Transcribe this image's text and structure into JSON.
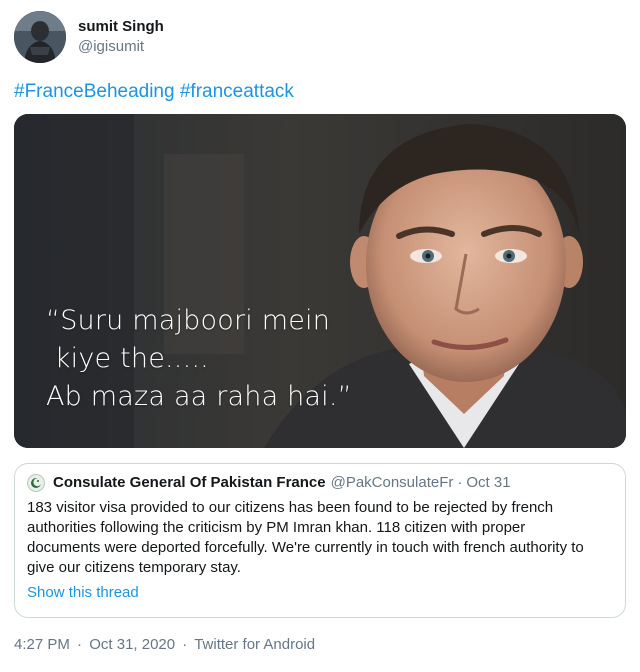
{
  "author": {
    "display_name": "sumit Singh",
    "handle": "@igisumit"
  },
  "hashtags": [
    "#FranceBeheading",
    "#franceattack"
  ],
  "media": {
    "quote_lines": [
      "“Suru majboori mein",
      " kiye the.....",
      "Ab maza aa raha hai.”"
    ]
  },
  "quoted_tweet": {
    "display_name": "Consulate General Of Pakistan France",
    "handle": "@PakConsulateFr",
    "separator": "·",
    "date": "Oct 31",
    "body": "183 visitor visa provided to our citizens has been found to be rejected by french authorities following the criticism by PM Imran khan. 118 citizen with proper documents were deported forcefully. We're currently in touch with french authority to give our citizens temporary stay.",
    "show_thread": "Show this thread"
  },
  "footer": {
    "time": "4:27 PM",
    "separator": "·",
    "date": "Oct 31, 2020",
    "source": "Twitter for Android"
  },
  "colors": {
    "link": "#1b95e0",
    "secondary_text": "#657786",
    "border": "#ccd6dd"
  }
}
